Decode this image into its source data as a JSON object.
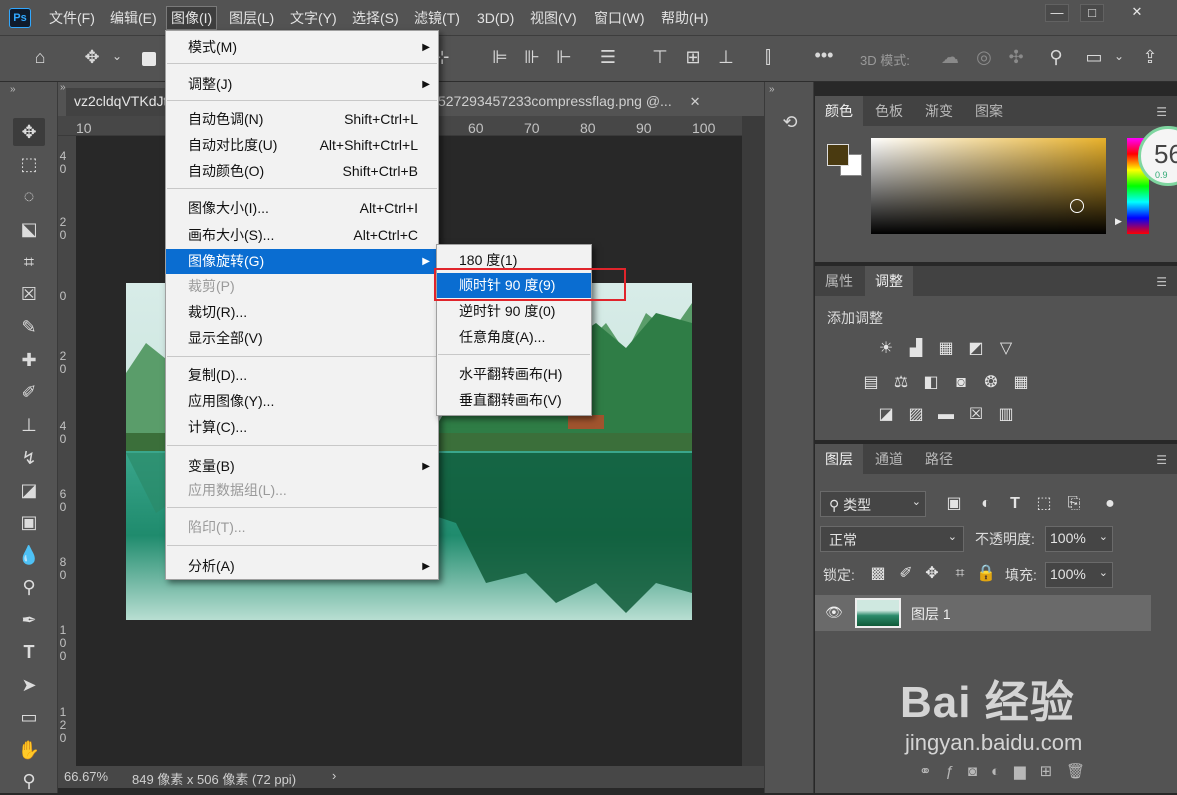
{
  "app": {
    "logo": "Ps"
  },
  "menubar": {
    "items": [
      "文件(F)",
      "编辑(E)",
      "图像(I)",
      "图层(L)",
      "文字(Y)",
      "选择(S)",
      "滤镜(T)",
      "3D(D)",
      "视图(V)",
      "窗口(W)",
      "帮助(H)"
    ],
    "active": "图像(I)"
  },
  "window_controls": {
    "minimize": "—",
    "maximize": "□",
    "close": "✕"
  },
  "options_bar": {
    "mode_3d_label": "3D 模式:"
  },
  "document": {
    "tab1_title": "vz2cldqVTKdJt",
    "tab2_title": "527293457233compressflag.png @...",
    "tab2_close": "✕",
    "ruler_top": [
      "10",
      "60",
      "70",
      "80",
      "90",
      "100"
    ],
    "ruler_left": [
      "4\n0",
      "2\n0",
      "0",
      "2\n0",
      "4\n0",
      "6\n0",
      "8\n0",
      "1\n0\n0",
      "1\n2\n0"
    ],
    "zoom": "66.67%",
    "info": "849 像素 x 506 像素 (72 ppi)"
  },
  "image_menu": {
    "groups": [
      [
        {
          "label": "模式(M)",
          "submenu": true
        }
      ],
      [
        {
          "label": "调整(J)",
          "submenu": true
        }
      ],
      [
        {
          "label": "自动色调(N)",
          "shortcut": "Shift+Ctrl+L"
        },
        {
          "label": "自动对比度(U)",
          "shortcut": "Alt+Shift+Ctrl+L"
        },
        {
          "label": "自动颜色(O)",
          "shortcut": "Shift+Ctrl+B"
        }
      ],
      [
        {
          "label": "图像大小(I)...",
          "shortcut": "Alt+Ctrl+I"
        },
        {
          "label": "画布大小(S)...",
          "shortcut": "Alt+Ctrl+C"
        },
        {
          "label": "图像旋转(G)",
          "submenu": true,
          "highlighted": true
        },
        {
          "label": "裁剪(P)",
          "disabled": true
        },
        {
          "label": "裁切(R)..."
        },
        {
          "label": "显示全部(V)"
        }
      ],
      [
        {
          "label": "复制(D)..."
        },
        {
          "label": "应用图像(Y)..."
        },
        {
          "label": "计算(C)..."
        }
      ],
      [
        {
          "label": "变量(B)",
          "submenu": true
        },
        {
          "label": "应用数据组(L)...",
          "disabled": true
        }
      ],
      [
        {
          "label": "陷印(T)...",
          "disabled": true
        }
      ],
      [
        {
          "label": "分析(A)",
          "submenu": true
        }
      ]
    ]
  },
  "rotate_submenu": {
    "items": [
      {
        "label": "180 度(1)"
      },
      {
        "label": "顺时针 90 度(9)",
        "highlighted": true
      },
      {
        "label": "逆时针 90 度(0)"
      },
      {
        "label": "任意角度(A)..."
      },
      {
        "label": "水平翻转画布(H)"
      },
      {
        "label": "垂直翻转画布(V)"
      }
    ]
  },
  "color_panel": {
    "tabs": [
      "颜色",
      "色板",
      "渐变",
      "图案"
    ],
    "foreground": "#4a3a10",
    "background": "#ffffff",
    "badge_number": "56",
    "badge_sub": "0.9"
  },
  "adjust_panel": {
    "tabs": [
      "属性",
      "调整"
    ],
    "title": "添加调整",
    "rows": [
      [
        "brightness-icon",
        "levels-icon",
        "curves-icon",
        "exposure-icon",
        "vibrance-icon"
      ],
      [
        "hue-icon",
        "color-balance-icon",
        "black-white-icon",
        "photo-filter-icon",
        "channel-mixer-icon",
        "color-lookup-icon"
      ],
      [
        "invert-icon",
        "posterize-icon",
        "threshold-icon",
        "selective-color-icon",
        "gradient-map-icon"
      ]
    ]
  },
  "layers_panel": {
    "tabs": [
      "图层",
      "通道",
      "路径"
    ],
    "filter_label": "类型",
    "blend_mode": "正常",
    "opacity_label": "不透明度:",
    "opacity": "100%",
    "lock_label": "锁定:",
    "fill_label": "填充:",
    "fill": "100%",
    "layer_name": "图层 1"
  },
  "watermark": {
    "main": "Bai 经验",
    "sub": "jingyan.baidu.com"
  }
}
